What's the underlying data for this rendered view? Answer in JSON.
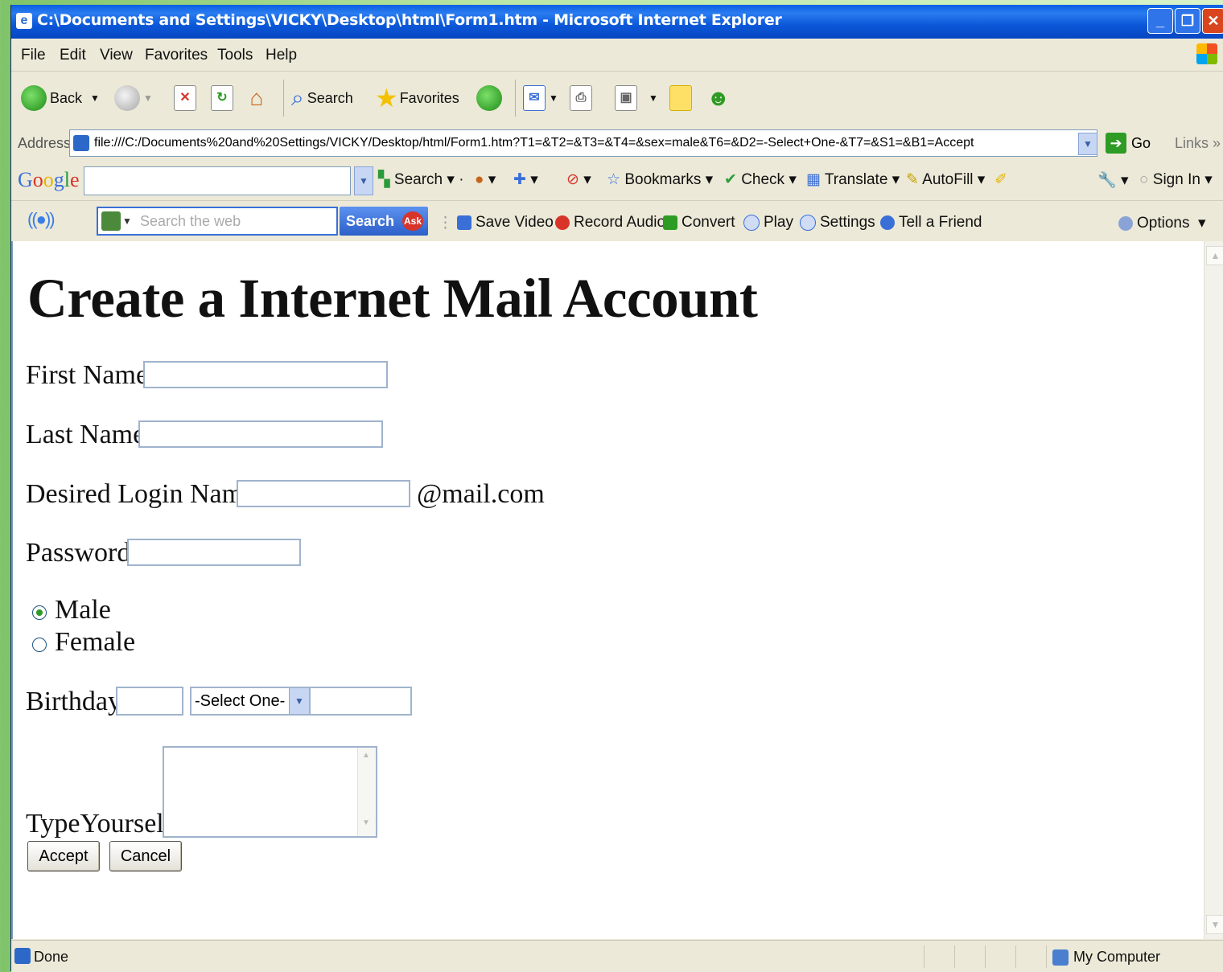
{
  "window": {
    "title": "C:\\Documents and Settings\\VICKY\\Desktop\\html\\Form1.htm - Microsoft Internet Explorer"
  },
  "menu": [
    "File",
    "Edit",
    "View",
    "Favorites",
    "Tools",
    "Help"
  ],
  "toolbar": {
    "back_label": "Back",
    "search_label": "Search",
    "favorites_label": "Favorites"
  },
  "address": {
    "label": "Address",
    "url": "file:///C:/Documents%20and%20Settings/VICKY/Desktop/html/Form1.htm?T1=&T2=&T3=&T4=&sex=male&T6=&D2=-Select+One-&T7=&S1=&B1=Accept",
    "go_label": "Go",
    "links_label": "Links"
  },
  "google_toolbar": {
    "logo": "Google",
    "search_label": "Search",
    "bookmarks_label": "Bookmarks",
    "check_label": "Check",
    "translate_label": "Translate",
    "autofill_label": "AutoFill",
    "signin_label": "Sign In"
  },
  "ask_toolbar": {
    "search_placeholder": "Search the web",
    "search_button": "Search",
    "ask_badge": "Ask",
    "save_video": "Save Video",
    "record_audio": "Record Audio",
    "convert": "Convert",
    "play": "Play",
    "settings": "Settings",
    "tell_friend": "Tell a Friend",
    "options": "Options"
  },
  "form": {
    "heading": "Create a Internet Mail Account",
    "first_name_label": "First Name",
    "last_name_label": "Last Name",
    "login_label": "Desired Login Name",
    "login_suffix": "@mail.com",
    "password_label": "Password",
    "male_label": "Male",
    "female_label": "Female",
    "selected_sex": "male",
    "birthday_label": "Birthday",
    "month_selected": "-Select One-",
    "type_yourself_label": "TypeYourself",
    "accept_button": "Accept",
    "cancel_button": "Cancel"
  },
  "status": {
    "text": "Done",
    "zone": "My Computer"
  },
  "colors": {
    "titlebar": "#0a5fe3",
    "chrome": "#ece9d8",
    "input_border": "#9fb3cc"
  }
}
